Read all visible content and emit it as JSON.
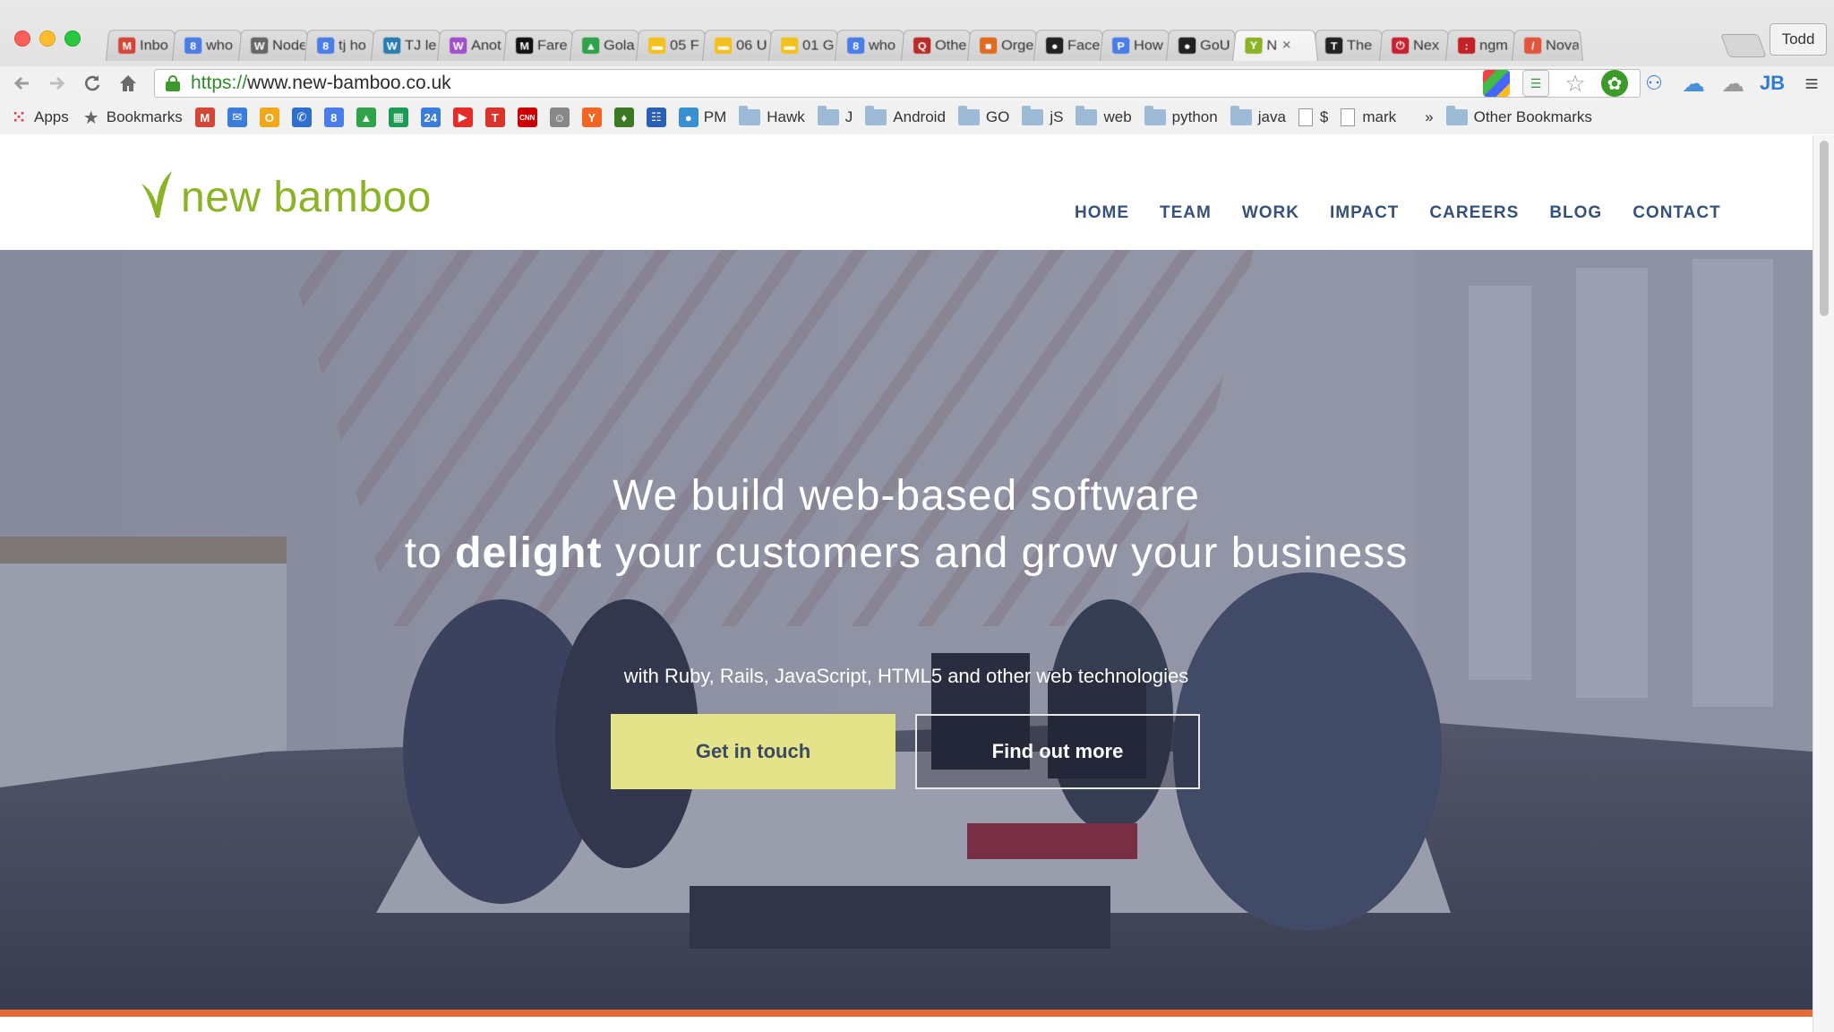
{
  "browser": {
    "tabs": [
      {
        "label": "Inbo",
        "icon": "gmail-icon",
        "color": "#d44638",
        "glyph": "M"
      },
      {
        "label": "who",
        "icon": "google-search-icon",
        "color": "#4a7de8",
        "glyph": "8"
      },
      {
        "label": "Node",
        "icon": "wikipedia-icon",
        "color": "#666666",
        "glyph": "W"
      },
      {
        "label": "tj ho",
        "icon": "google-search-icon",
        "color": "#4a7de8",
        "glyph": "8"
      },
      {
        "label": "TJ le",
        "icon": "wordpress-icon",
        "color": "#2a7db3",
        "glyph": "W"
      },
      {
        "label": "Anot",
        "icon": "w-icon",
        "color": "#a050c8",
        "glyph": "W"
      },
      {
        "label": "Fare",
        "icon": "medium-icon",
        "color": "#111111",
        "glyph": "M"
      },
      {
        "label": "Gola",
        "icon": "drive-icon",
        "color": "#2fa34a",
        "glyph": "▲"
      },
      {
        "label": "05 F",
        "icon": "slides-icon",
        "color": "#f4c01b",
        "glyph": "▬"
      },
      {
        "label": "06 U",
        "icon": "slides-icon",
        "color": "#f4c01b",
        "glyph": "▬"
      },
      {
        "label": "01 G",
        "icon": "slides-icon",
        "color": "#f4c01b",
        "glyph": "▬"
      },
      {
        "label": "who",
        "icon": "google-search-icon",
        "color": "#4a7de8",
        "glyph": "8"
      },
      {
        "label": "Othe",
        "icon": "quora-icon",
        "color": "#b92b27",
        "glyph": "Q"
      },
      {
        "label": "Orge",
        "icon": "orange-square-icon",
        "color": "#e06a21",
        "glyph": "■"
      },
      {
        "label": "Face",
        "icon": "github-icon",
        "color": "#222222",
        "glyph": "●"
      },
      {
        "label": "How",
        "icon": "p-icon",
        "color": "#4a7de8",
        "glyph": "P"
      },
      {
        "label": "GoU",
        "icon": "github-icon",
        "color": "#222222",
        "glyph": "●"
      },
      {
        "label": "N",
        "icon": "new-bamboo-icon",
        "color": "#8ab326",
        "glyph": "Y"
      },
      {
        "label": "The",
        "icon": "nyt-icon",
        "color": "#222222",
        "glyph": "T"
      },
      {
        "label": "Nex",
        "icon": "power-icon",
        "color": "#c8202f",
        "glyph": "⏻"
      },
      {
        "label": "ngm",
        "icon": "npm-icon",
        "color": "#c12127",
        "glyph": ":"
      },
      {
        "label": "Nova",
        "icon": "nova-icon",
        "color": "#e0553d",
        "glyph": "/"
      }
    ],
    "active_tab_index": 17,
    "profile_name": "Todd",
    "url_proto": "https://",
    "url_rest": "www.new-bamboo.co.uk",
    "bookmarks": [
      {
        "type": "apps",
        "label": "Apps"
      },
      {
        "type": "star",
        "label": "Bookmarks"
      },
      {
        "type": "icon",
        "icon": "gmail-icon",
        "color": "#d44638",
        "glyph": "M"
      },
      {
        "type": "icon",
        "icon": "mailbox-icon",
        "color": "#3b7ddd",
        "glyph": "✉"
      },
      {
        "type": "icon",
        "icon": "o-icon",
        "color": "#f2a81b",
        "glyph": "O"
      },
      {
        "type": "icon",
        "icon": "phone-icon",
        "color": "#2f6fd0",
        "glyph": "✆"
      },
      {
        "type": "icon",
        "icon": "google-search-icon",
        "color": "#4a7de8",
        "glyph": "8"
      },
      {
        "type": "icon",
        "icon": "drive-icon",
        "color": "#2fa34a",
        "glyph": "▲"
      },
      {
        "type": "icon",
        "icon": "sheets-icon",
        "color": "#1d9b55",
        "glyph": "▦"
      },
      {
        "type": "icon",
        "icon": "calendar-icon",
        "color": "#3b7ddd",
        "glyph": "24"
      },
      {
        "type": "icon",
        "icon": "youtube-icon",
        "color": "#e52d27",
        "glyph": "▶"
      },
      {
        "type": "icon",
        "icon": "t-icon",
        "color": "#d9342b",
        "glyph": "T"
      },
      {
        "type": "icon",
        "icon": "cnn-icon",
        "color": "#cc0000",
        "glyph": "CNN"
      },
      {
        "type": "icon",
        "icon": "reddit-icon",
        "color": "#888888",
        "glyph": "☺"
      },
      {
        "type": "icon",
        "icon": "hacker-news-icon",
        "color": "#f26522",
        "glyph": "Y"
      },
      {
        "type": "icon",
        "icon": "drop-icon",
        "color": "#3b7a22",
        "glyph": "♦"
      },
      {
        "type": "icon",
        "icon": "people-icon",
        "color": "#2b5fb5",
        "glyph": "☷"
      },
      {
        "type": "icon-label",
        "icon": "globe-icon",
        "color": "#3a8fd0",
        "glyph": "●",
        "label": "PM"
      },
      {
        "type": "folder",
        "label": "Hawk"
      },
      {
        "type": "folder",
        "label": "J"
      },
      {
        "type": "folder",
        "label": "Android"
      },
      {
        "type": "folder",
        "label": "GO"
      },
      {
        "type": "folder",
        "label": "jS"
      },
      {
        "type": "folder",
        "label": "web"
      },
      {
        "type": "folder",
        "label": "python"
      },
      {
        "type": "folder",
        "label": "java"
      },
      {
        "type": "page",
        "label": "$"
      },
      {
        "type": "page",
        "label": "mark"
      }
    ],
    "overflow_label": "»",
    "other_bookmarks_label": "Other Bookmarks"
  },
  "site": {
    "logo_text": "new bamboo",
    "nav": [
      "HOME",
      "TEAM",
      "WORK",
      "IMPACT",
      "CAREERS",
      "BLOG",
      "CONTACT"
    ],
    "headline_line1": "We build web-based software",
    "headline_to": "to",
    "headline_strong": "delight",
    "headline_rest": "your customers and grow your business",
    "subline": "with Ruby, Rails, JavaScript, HTML5 and other web technologies",
    "cta_primary": "Get in touch",
    "cta_secondary": "Find out more"
  },
  "colors": {
    "brand_green": "#8ab326",
    "nav_blue": "#36517d",
    "cta_yellow": "#e4e38a",
    "accent_orange": "#e56b38"
  }
}
